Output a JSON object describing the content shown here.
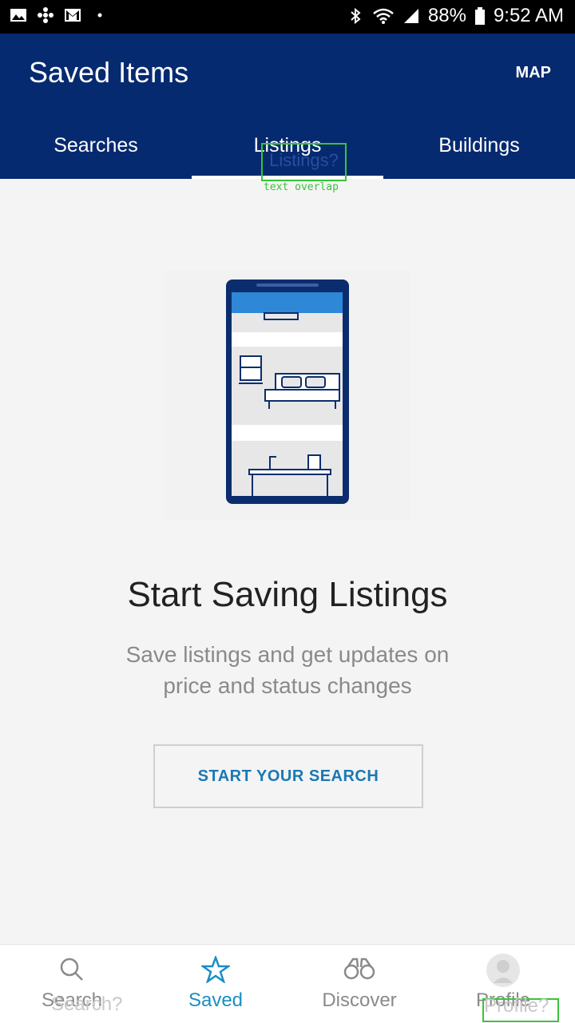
{
  "status_bar": {
    "battery": "88%",
    "time": "9:52 AM",
    "icons": [
      "image-icon",
      "pinwheel-icon",
      "gmail-icon",
      "dot-icon",
      "bluetooth-icon",
      "wifi-icon",
      "signal-icon",
      "battery-icon"
    ]
  },
  "header": {
    "title": "Saved Items",
    "map_label": "MAP",
    "background": "#062a70"
  },
  "tabs": [
    {
      "label": "Searches",
      "active": false
    },
    {
      "label": "Listings",
      "active": true
    },
    {
      "label": "Buildings",
      "active": false
    }
  ],
  "overlay": {
    "box_text": "Listings?",
    "label": "text overlap"
  },
  "empty_state": {
    "headline": "Start Saving Listings",
    "subtext": "Save listings and get updates on price and status changes",
    "cta_label": "START YOUR SEARCH",
    "accent": "#1a78b4"
  },
  "bottom_nav": [
    {
      "label": "Search",
      "icon": "search-icon",
      "active": false
    },
    {
      "label": "Saved",
      "icon": "star-icon",
      "active": true
    },
    {
      "label": "Discover",
      "icon": "binoculars-icon",
      "active": false
    },
    {
      "label": "Profile",
      "icon": "avatar-icon",
      "active": false
    }
  ],
  "ghost_labels": {
    "search": "Search?",
    "profile": "Profile?"
  }
}
